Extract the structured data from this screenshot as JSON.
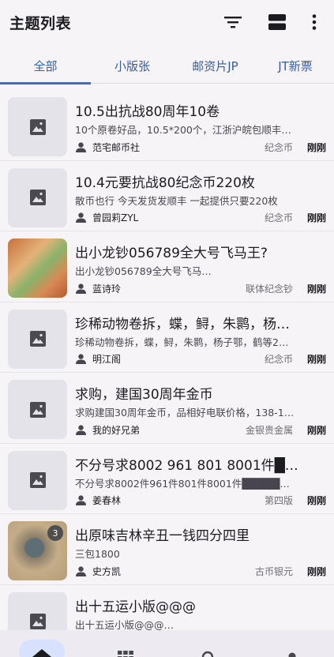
{
  "topbar": {
    "title": "主题列表",
    "icons": [
      "filter-icon",
      "view-toggle-icon",
      "more-vert-icon"
    ]
  },
  "tabs": [
    {
      "label": "全部",
      "active": true
    },
    {
      "label": "小版张",
      "active": false
    },
    {
      "label": "邮资片JP",
      "active": false
    },
    {
      "label": "JT新票",
      "active": false
    }
  ],
  "items": [
    {
      "title": "10.5出抗战80周年10卷",
      "desc": "10个原卷好品，10.5*200个，江浙沪皖包顺丰…",
      "author": "范宅邮币社",
      "category": "纪念币",
      "time": "刚刚",
      "thumb": "placeholder"
    },
    {
      "title": "10.4元要抗战80纪念币220枚",
      "desc": "散币也行 今天发货发顺丰 一起提供只要220枚",
      "author": "曾园莉ZYL",
      "category": "纪念币",
      "time": "刚刚",
      "thumb": "placeholder"
    },
    {
      "title": "出小龙钞056789全大号飞马王?",
      "desc": "出小龙钞056789全大号飞马…",
      "author": "蓝诗玲",
      "category": "联体纪念钞",
      "time": "刚刚",
      "thumb": "photo-stamp"
    },
    {
      "title": "珍稀动物卷拆，蝶，鲟，朱鹮，杨…",
      "desc": "珍稀动物卷拆，蝶，鲟，朱鹮，杨子鄂，鹤等2…",
      "author": "明江阁",
      "category": "纪念币",
      "time": "刚刚",
      "thumb": "placeholder"
    },
    {
      "title": "求购，建国30周年金币",
      "desc": "求购建国30周年金币，品相好电联价格，138-1…",
      "author": "我的好兄弟",
      "category": "金银贵金属",
      "time": "刚刚",
      "thumb": "placeholder"
    },
    {
      "title": "不分号求8002 961 801 8001件█…",
      "desc": "不分号求8002件961件801件8001件█████…",
      "author": "姜春林",
      "category": "第四版",
      "time": "刚刚",
      "thumb": "placeholder"
    },
    {
      "title": "出原味吉林辛丑一钱四分四里",
      "desc": "三包1800",
      "author": "史方凯",
      "category": "古币银元",
      "time": "刚刚",
      "thumb": "photo-coin",
      "badge": "3"
    },
    {
      "title": "出十五运小版@@@",
      "desc": "出十五运小版@@@…",
      "author": "",
      "category": "",
      "time": "",
      "thumb": "placeholder"
    }
  ],
  "bottomnav": [
    {
      "icon": "home-icon",
      "active": true
    },
    {
      "icon": "grid-icon",
      "active": false
    },
    {
      "icon": "search-icon",
      "active": false
    },
    {
      "icon": "profile-icon",
      "active": false
    }
  ]
}
